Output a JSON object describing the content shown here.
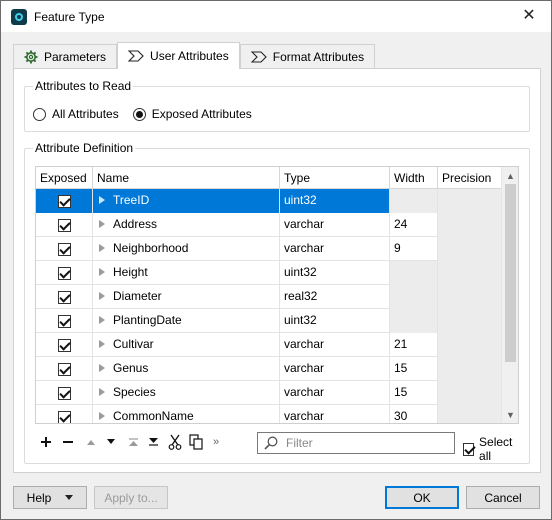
{
  "window": {
    "title": "Feature Type"
  },
  "tabs": [
    {
      "label": "Parameters",
      "icon": "gear-icon",
      "active": false
    },
    {
      "label": "User Attributes",
      "icon": "user-attributes-icon",
      "active": true
    },
    {
      "label": "Format Attributes",
      "icon": "format-attributes-icon",
      "active": false
    }
  ],
  "attributes_to_read": {
    "title": "Attributes to Read",
    "options": [
      {
        "label": "All Attributes",
        "checked": false
      },
      {
        "label": "Exposed Attributes",
        "checked": true
      }
    ]
  },
  "attribute_definition": {
    "title": "Attribute Definition",
    "columns": [
      "Exposed",
      "Name",
      "Type",
      "Width",
      "Precision"
    ],
    "rows": [
      {
        "exposed": true,
        "name": "TreeID",
        "type": "uint32",
        "width": "",
        "precision": "",
        "selected": true,
        "width_grey": true,
        "precision_grey": true
      },
      {
        "exposed": true,
        "name": "Address",
        "type": "varchar",
        "width": "24",
        "precision": "",
        "selected": false,
        "width_grey": false,
        "precision_grey": true
      },
      {
        "exposed": true,
        "name": "Neighborhood",
        "type": "varchar",
        "width": "9",
        "precision": "",
        "selected": false,
        "width_grey": false,
        "precision_grey": true
      },
      {
        "exposed": true,
        "name": "Height",
        "type": "uint32",
        "width": "",
        "precision": "",
        "selected": false,
        "width_grey": true,
        "precision_grey": true
      },
      {
        "exposed": true,
        "name": "Diameter",
        "type": "real32",
        "width": "",
        "precision": "",
        "selected": false,
        "width_grey": true,
        "precision_grey": true
      },
      {
        "exposed": true,
        "name": "PlantingDate",
        "type": "uint32",
        "width": "",
        "precision": "",
        "selected": false,
        "width_grey": true,
        "precision_grey": true
      },
      {
        "exposed": true,
        "name": "Cultivar",
        "type": "varchar",
        "width": "21",
        "precision": "",
        "selected": false,
        "width_grey": false,
        "precision_grey": true
      },
      {
        "exposed": true,
        "name": "Genus",
        "type": "varchar",
        "width": "15",
        "precision": "",
        "selected": false,
        "width_grey": false,
        "precision_grey": true
      },
      {
        "exposed": true,
        "name": "Species",
        "type": "varchar",
        "width": "15",
        "precision": "",
        "selected": false,
        "width_grey": false,
        "precision_grey": true
      },
      {
        "exposed": true,
        "name": "CommonName",
        "type": "varchar",
        "width": "30",
        "precision": "",
        "selected": false,
        "width_grey": false,
        "precision_grey": true
      }
    ]
  },
  "toolbar": {
    "more_label": "»",
    "filter_placeholder": "Filter",
    "filter_value": "",
    "select_all_label": "Select all",
    "select_all_checked": true
  },
  "footer": {
    "help_label": "Help",
    "apply_label": "Apply to...",
    "ok_label": "OK",
    "cancel_label": "Cancel"
  },
  "colors": {
    "selection": "#0078d7",
    "accent_border": "#0078d7"
  }
}
